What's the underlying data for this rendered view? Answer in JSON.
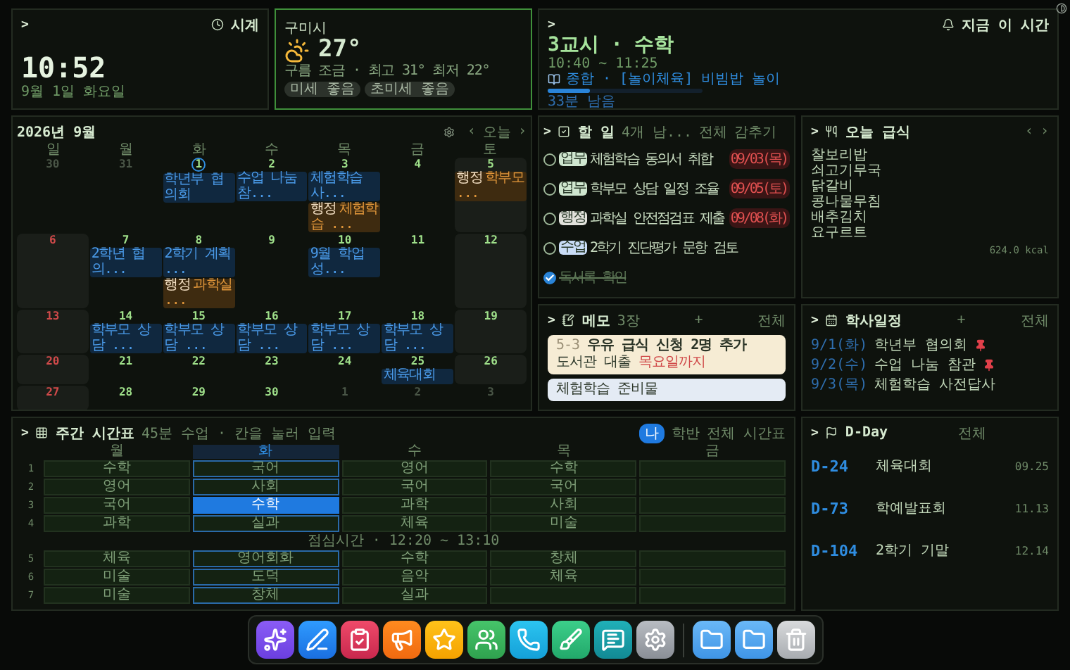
{
  "clock": {
    "prompt": ">",
    "label": "시계",
    "time": "10:52",
    "date": "9월 1일 화요일"
  },
  "weather": {
    "city": "구미시",
    "temp": "27°",
    "summary": "구름 조금 · 최고 31° 최저 22°",
    "chips": [
      "미세 좋음",
      "초미세 좋음"
    ]
  },
  "now": {
    "prompt": ">",
    "label": "지금 이 시간",
    "title": "3교시 · 수학",
    "time": "10:40 ~ 11:25",
    "lesson": "종합 · [놀이체육] 비빔밥 놀이",
    "level": 0.27,
    "remaining": "33분 남음"
  },
  "calendar": {
    "title": "2026년 9월",
    "today_button": "오늘",
    "prev": "‹",
    "next": "›",
    "weekdays": [
      "일",
      "월",
      "화",
      "수",
      "목",
      "금",
      "토"
    ],
    "weeks": [
      {
        "days": [
          {
            "label": "30",
            "muted": true,
            "today": false
          },
          {
            "label": "31",
            "muted": true,
            "today": false
          },
          {
            "label": "1",
            "muted": false,
            "today": true,
            "events": [
              {
                "kind": "plain",
                "text": "학년부 협의회"
              }
            ]
          },
          {
            "label": "2",
            "muted": false,
            "today": false,
            "events": [
              {
                "kind": "plain",
                "text": "수업 나눔 참..."
              }
            ]
          },
          {
            "label": "3",
            "muted": false,
            "today": false,
            "events": [
              {
                "kind": "plain",
                "text": "체험학습 사..."
              },
              {
                "kind": "tagged",
                "tag": "행정",
                "text": "체험학습 ..."
              }
            ]
          },
          {
            "label": "4",
            "muted": false,
            "today": false
          },
          {
            "label": "5",
            "muted": false,
            "today": false,
            "events": [
              {
                "kind": "tagged",
                "tag": "행정",
                "text": "학부모 ..."
              }
            ]
          }
        ]
      },
      {
        "days": [
          {
            "label": "6",
            "muted": false,
            "today": false
          },
          {
            "label": "7",
            "muted": false,
            "today": false,
            "events": [
              {
                "kind": "plain",
                "text": "2학년 협의..."
              }
            ]
          },
          {
            "label": "8",
            "muted": false,
            "today": false,
            "events": [
              {
                "kind": "plain",
                "text": "2학기 계획 ..."
              },
              {
                "kind": "tagged",
                "tag": "행정",
                "text": "과학실 ..."
              }
            ]
          },
          {
            "label": "9",
            "muted": false,
            "today": false
          },
          {
            "label": "10",
            "muted": false,
            "today": false,
            "events": [
              {
                "kind": "plain",
                "text": "9월 학업성..."
              }
            ]
          },
          {
            "label": "11",
            "muted": false,
            "today": false
          },
          {
            "label": "12",
            "muted": false,
            "today": false
          }
        ]
      },
      {
        "days": [
          {
            "label": "13",
            "muted": false,
            "today": false
          },
          {
            "label": "14",
            "muted": false,
            "today": false,
            "events": [
              {
                "kind": "plain",
                "text": "학부모 상담 ..."
              }
            ]
          },
          {
            "label": "15",
            "muted": false,
            "today": false,
            "events": [
              {
                "kind": "plain",
                "text": "학부모 상담 ..."
              }
            ]
          },
          {
            "label": "16",
            "muted": false,
            "today": false,
            "events": [
              {
                "kind": "plain",
                "text": "학부모 상담 ..."
              }
            ]
          },
          {
            "label": "17",
            "muted": false,
            "today": false,
            "events": [
              {
                "kind": "plain",
                "text": "학부모 상담 ..."
              }
            ]
          },
          {
            "label": "18",
            "muted": false,
            "today": false,
            "events": [
              {
                "kind": "plain",
                "text": "학부모 상담 ..."
              }
            ]
          },
          {
            "label": "19",
            "muted": false,
            "today": false
          }
        ]
      },
      {
        "days": [
          {
            "label": "20",
            "muted": false,
            "today": false
          },
          {
            "label": "21",
            "muted": false,
            "today": false
          },
          {
            "label": "22",
            "muted": false,
            "today": false
          },
          {
            "label": "23",
            "muted": false,
            "today": false
          },
          {
            "label": "24",
            "muted": false,
            "today": false
          },
          {
            "label": "25",
            "muted": false,
            "today": false,
            "events": [
              {
                "kind": "plain",
                "text": "체육대회"
              }
            ]
          },
          {
            "label": "26",
            "muted": false,
            "today": false
          }
        ]
      },
      {
        "days": [
          {
            "label": "27",
            "muted": false,
            "today": false
          },
          {
            "label": "28",
            "muted": false,
            "today": false
          },
          {
            "label": "29",
            "muted": false,
            "today": false
          },
          {
            "label": "30",
            "muted": false,
            "today": false
          },
          {
            "label": "1",
            "muted": true,
            "today": false
          },
          {
            "label": "2",
            "muted": true,
            "today": false
          },
          {
            "label": "3",
            "muted": true,
            "today": false
          }
        ]
      }
    ]
  },
  "todo": {
    "prompt": ">",
    "title": "할 일",
    "count": "4개 남...",
    "all": "전체",
    "hide": "감추기",
    "items": [
      {
        "tag": "업무",
        "color": "#cfe6cf",
        "text": "체험학습 동의서 취합",
        "due": "09/03(목)",
        "done": false
      },
      {
        "tag": "업무",
        "color": "#cfe6cf",
        "text": "학부모 상담 일정 조율",
        "due": "09/05(토)",
        "done": false
      },
      {
        "tag": "행정",
        "color": "#e2e2dc",
        "text": "과학실 안전점검표 제출",
        "due": "09/08(화)",
        "done": false
      },
      {
        "tag": "수업",
        "color": "#c9dcf6",
        "text": "2학기 진단평가 문항 검토",
        "done": false
      },
      {
        "text": "독서록 확인",
        "done": true
      }
    ]
  },
  "meal": {
    "prompt": ">",
    "title": "오늘 급식",
    "prev": "‹",
    "next": "›",
    "dishes": [
      "찰보리밥",
      "쇠고기무국",
      "닭갈비",
      "콩나물무침",
      "배추김치",
      "요구르트"
    ],
    "kcal": "624.0 kcal"
  },
  "memo": {
    "prompt": ">",
    "title": "메모",
    "count": "3장",
    "add": "+",
    "all": "전체",
    "notes": [
      {
        "color": "#f6ecd4",
        "lines": [
          [
            {
              "kind": "dim",
              "text": "5-3 "
            },
            {
              "kind": "bold",
              "text": "우유 급식 신청 2명 추가"
            }
          ],
          [
            {
              "kind": "plain",
              "text": "도서관 대출 "
            },
            {
              "kind": "alert",
              "text": "목요일까지"
            }
          ]
        ]
      },
      {
        "color": "#e4ebf4",
        "lines": [
          [
            {
              "kind": "plain",
              "text": "체험학습 준비물"
            }
          ]
        ]
      }
    ]
  },
  "schedule": {
    "prompt": ">",
    "title": "학사일정",
    "add": "+",
    "all": "전체",
    "items": [
      {
        "date": "9/1(화)",
        "text": "학년부 협의회",
        "pinned": true
      },
      {
        "date": "9/2(수)",
        "text": "수업 나눔 참관",
        "pinned": true
      },
      {
        "date": "9/3(목)",
        "text": "체험학습 사전답사",
        "pinned": false
      }
    ]
  },
  "timetable": {
    "prompt": ">",
    "title": "주간 시간표",
    "hint": "45분 수업 · 칸을 눌러 입력",
    "badge": "나",
    "class_link": "학반",
    "all_link": "전체 시간표",
    "columns": [
      {
        "label": "월",
        "today": false
      },
      {
        "label": "화",
        "today": true
      },
      {
        "label": "수",
        "today": false
      },
      {
        "label": "목",
        "today": false
      },
      {
        "label": "금",
        "today": false
      }
    ],
    "rows": [
      {
        "kind": "period",
        "label": "1",
        "cells": [
          {
            "text": "수학",
            "selected": false
          },
          {
            "text": "국어",
            "selected": false
          },
          {
            "text": "영어",
            "selected": false
          },
          {
            "text": "수학",
            "selected": false
          },
          {
            "selected": false
          }
        ]
      },
      {
        "kind": "period",
        "label": "2",
        "cells": [
          {
            "text": "영어",
            "selected": false
          },
          {
            "text": "사회",
            "selected": false
          },
          {
            "text": "국어",
            "selected": false
          },
          {
            "text": "국어",
            "selected": false
          },
          {
            "selected": false
          }
        ]
      },
      {
        "kind": "period",
        "label": "3",
        "cells": [
          {
            "text": "국어",
            "selected": false
          },
          {
            "text": "수학",
            "selected": true
          },
          {
            "text": "과학",
            "selected": false
          },
          {
            "text": "사회",
            "selected": false
          },
          {
            "selected": false
          }
        ]
      },
      {
        "kind": "period",
        "label": "4",
        "cells": [
          {
            "text": "과학",
            "selected": false
          },
          {
            "text": "실과",
            "selected": false
          },
          {
            "text": "체육",
            "selected": false
          },
          {
            "text": "미술",
            "selected": false
          },
          {
            "selected": false
          }
        ]
      },
      {
        "kind": "break",
        "text": "점심시간 · 12:20 ~ 13:10"
      },
      {
        "kind": "period",
        "label": "5",
        "cells": [
          {
            "text": "체육",
            "selected": false
          },
          {
            "text": "영어회화",
            "selected": false
          },
          {
            "text": "수학",
            "selected": false
          },
          {
            "text": "창체",
            "selected": false
          },
          {
            "selected": false
          }
        ]
      },
      {
        "kind": "period",
        "label": "6",
        "cells": [
          {
            "text": "미술",
            "selected": false
          },
          {
            "text": "도덕",
            "selected": false
          },
          {
            "text": "음악",
            "selected": false
          },
          {
            "text": "체육",
            "selected": false
          },
          {
            "selected": false
          }
        ]
      },
      {
        "kind": "period",
        "label": "7",
        "cells": [
          {
            "text": "미술",
            "selected": false
          },
          {
            "text": "창체",
            "selected": false
          },
          {
            "text": "실과",
            "selected": false
          },
          {
            "selected": false
          },
          {
            "selected": false
          }
        ]
      }
    ]
  },
  "dday": {
    "prompt": ">",
    "title": "D-Day",
    "all": "전체",
    "items": [
      {
        "count": "D-24",
        "text": "체육대회",
        "date": "09.25"
      },
      {
        "count": "D-73",
        "text": "학예발표회",
        "date": "11.13"
      },
      {
        "count": "D-104",
        "text": "2학기 기말",
        "date": "12.14"
      }
    ]
  }
}
